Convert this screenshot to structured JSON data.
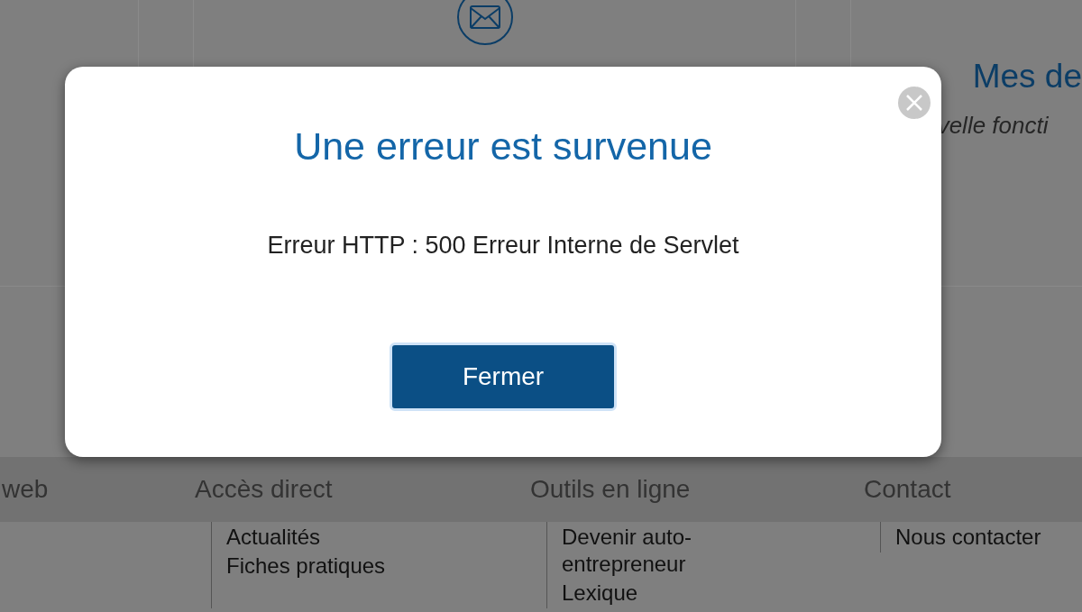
{
  "page": {
    "right_card": {
      "title": "Mes de",
      "text": "velle foncti"
    },
    "footer": {
      "columns": [
        {
          "heading": "web"
        },
        {
          "heading": "Accès direct",
          "links": [
            "Actualités",
            "Fiches pratiques"
          ]
        },
        {
          "heading": "Outils en ligne",
          "links": [
            "Devenir auto-entrepreneur",
            "Lexique"
          ]
        },
        {
          "heading": "Contact",
          "links": [
            "Nous contacter"
          ]
        }
      ]
    }
  },
  "dialog": {
    "title": "Une erreur est survenue",
    "message": "Erreur HTTP : 500 Erreur Interne de Servlet",
    "button": "Fermer"
  }
}
